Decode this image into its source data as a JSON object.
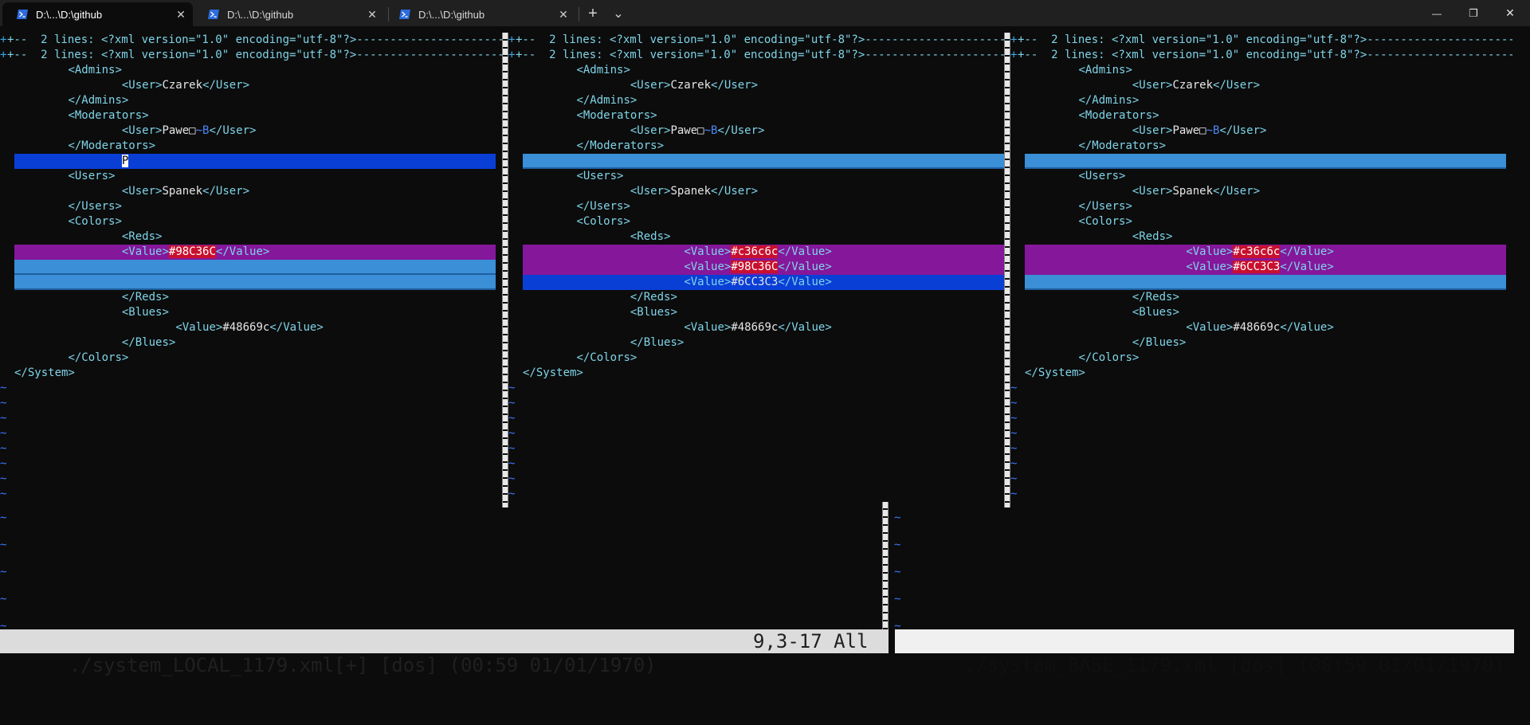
{
  "tabs": [
    {
      "label": "D:\\...\\D:\\github",
      "close": "✕",
      "active": true
    },
    {
      "label": "D:\\...\\D:\\github",
      "close": "✕",
      "active": false
    },
    {
      "label": "D:\\...\\D:\\github",
      "close": "✕",
      "active": false
    }
  ],
  "toolbar": {
    "new_tab": "+",
    "dropdown": "⌄"
  },
  "window_controls": {
    "minimize": "—",
    "restore": "❐",
    "close": "✕"
  },
  "colors": {
    "diff_add_line": "#0a3fd6",
    "diff_change_line": "#85179b",
    "diff_change_text": "#c8102e",
    "diff_delete_filler": "#3a8fd6",
    "background": "#0c0c0c",
    "tag": "#7fd4e8",
    "tilde": "#3b78ff"
  },
  "fold_text": "+--  2 lines: <?xml version=\"1.0\" encoding=\"utf-8\"?>-------------------------------",
  "panes": [
    {
      "name": "local",
      "cursor_char": "P",
      "lines": [
        {
          "type": "fold",
          "sign": "+"
        },
        {
          "type": "fold",
          "sign": "+"
        },
        {
          "type": "code",
          "indent": 1,
          "tag": "<Admins>"
        },
        {
          "type": "code",
          "indent": 2,
          "open": "<User>",
          "text": "Czarek",
          "close": "</User>"
        },
        {
          "type": "code",
          "indent": 1,
          "tag": "</Admins>"
        },
        {
          "type": "code",
          "indent": 1,
          "tag": "<Moderators>"
        },
        {
          "type": "code",
          "indent": 2,
          "open": "<User>",
          "text": "Pawe□",
          "special": "~B",
          "close": "</User>"
        },
        {
          "type": "code",
          "indent": 1,
          "tag": "</Moderators>"
        },
        {
          "type": "add",
          "indent": 2,
          "cursor": true
        },
        {
          "type": "code",
          "indent": 1,
          "tag": "<Users>"
        },
        {
          "type": "code",
          "indent": 2,
          "open": "<User>",
          "text": "Spanek",
          "close": "</User>"
        },
        {
          "type": "code",
          "indent": 1,
          "tag": "</Users>"
        },
        {
          "type": "code",
          "indent": 1,
          "tag": "<Colors>"
        },
        {
          "type": "code",
          "indent": 2,
          "tag": "<Reds>"
        },
        {
          "type": "change",
          "indent": 2,
          "open": "<Value>",
          "text": "#98C36C",
          "close": "</Value>"
        },
        {
          "type": "filler"
        },
        {
          "type": "filler"
        },
        {
          "type": "code",
          "indent": 2,
          "tag": "</Reds>"
        },
        {
          "type": "code",
          "indent": 2,
          "tag": "<Blues>"
        },
        {
          "type": "code",
          "indent": 3,
          "open": "<Value>",
          "text": "#48669c",
          "close": "</Value>"
        },
        {
          "type": "code",
          "indent": 2,
          "tag": "</Blues>"
        },
        {
          "type": "code",
          "indent": 1,
          "tag": "</Colors>"
        },
        {
          "type": "code",
          "indent": 0,
          "tag": "</System>"
        }
      ]
    },
    {
      "name": "remote",
      "lines": [
        {
          "type": "fold",
          "sign": "+"
        },
        {
          "type": "fold",
          "sign": "+"
        },
        {
          "type": "code",
          "indent": 1,
          "tag": "<Admins>"
        },
        {
          "type": "code",
          "indent": 2,
          "open": "<User>",
          "text": "Czarek",
          "close": "</User>"
        },
        {
          "type": "code",
          "indent": 1,
          "tag": "</Admins>"
        },
        {
          "type": "code",
          "indent": 1,
          "tag": "<Moderators>"
        },
        {
          "type": "code",
          "indent": 2,
          "open": "<User>",
          "text": "Pawe□",
          "special": "~B",
          "close": "</User>"
        },
        {
          "type": "code",
          "indent": 1,
          "tag": "</Moderators>"
        },
        {
          "type": "filler"
        },
        {
          "type": "code",
          "indent": 1,
          "tag": "<Users>"
        },
        {
          "type": "code",
          "indent": 2,
          "open": "<User>",
          "text": "Spanek",
          "close": "</User>"
        },
        {
          "type": "code",
          "indent": 1,
          "tag": "</Users>"
        },
        {
          "type": "code",
          "indent": 1,
          "tag": "<Colors>"
        },
        {
          "type": "code",
          "indent": 2,
          "tag": "<Reds>"
        },
        {
          "type": "change",
          "indent": 3,
          "open": "<Value>",
          "text": "#c36c6c",
          "close": "</Value>"
        },
        {
          "type": "change2",
          "indent": 3,
          "open": "<Value>",
          "text": "#98C36C",
          "close": "</Value>"
        },
        {
          "type": "addline",
          "indent": 3,
          "open": "<Value>",
          "text": "#6CC3C3",
          "close": "</Value>"
        },
        {
          "type": "code",
          "indent": 2,
          "tag": "</Reds>"
        },
        {
          "type": "code",
          "indent": 2,
          "tag": "<Blues>"
        },
        {
          "type": "code",
          "indent": 3,
          "open": "<Value>",
          "text": "#48669c",
          "close": "</Value>"
        },
        {
          "type": "code",
          "indent": 2,
          "tag": "</Blues>"
        },
        {
          "type": "code",
          "indent": 1,
          "tag": "</Colors>"
        },
        {
          "type": "code",
          "indent": 0,
          "tag": "</System>"
        }
      ]
    },
    {
      "name": "base",
      "lines": [
        {
          "type": "fold",
          "sign": "+"
        },
        {
          "type": "fold",
          "sign": "+"
        },
        {
          "type": "code",
          "indent": 1,
          "tag": "<Admins>"
        },
        {
          "type": "code",
          "indent": 2,
          "open": "<User>",
          "text": "Czarek",
          "close": "</User>"
        },
        {
          "type": "code",
          "indent": 1,
          "tag": "</Admins>"
        },
        {
          "type": "code",
          "indent": 1,
          "tag": "<Moderators>"
        },
        {
          "type": "code",
          "indent": 2,
          "open": "<User>",
          "text": "Pawe□",
          "special": "~B",
          "close": "</User>"
        },
        {
          "type": "code",
          "indent": 1,
          "tag": "</Moderators>"
        },
        {
          "type": "filler"
        },
        {
          "type": "code",
          "indent": 1,
          "tag": "<Users>"
        },
        {
          "type": "code",
          "indent": 2,
          "open": "<User>",
          "text": "Spanek",
          "close": "</User>"
        },
        {
          "type": "code",
          "indent": 1,
          "tag": "</Users>"
        },
        {
          "type": "code",
          "indent": 1,
          "tag": "<Colors>"
        },
        {
          "type": "code",
          "indent": 2,
          "tag": "<Reds>"
        },
        {
          "type": "change",
          "indent": 3,
          "open": "<Value>",
          "text": "#c36c6c",
          "close": "</Value>"
        },
        {
          "type": "change2",
          "indent": 3,
          "open": "<Value>",
          "text": "#6CC3C3",
          "close": "</Value>"
        },
        {
          "type": "filler"
        },
        {
          "type": "code",
          "indent": 2,
          "tag": "</Reds>"
        },
        {
          "type": "code",
          "indent": 2,
          "tag": "<Blues>"
        },
        {
          "type": "code",
          "indent": 3,
          "open": "<Value>",
          "text": "#48669c",
          "close": "</Value>"
        },
        {
          "type": "code",
          "indent": 2,
          "tag": "</Blues>"
        },
        {
          "type": "code",
          "indent": 1,
          "tag": "</Colors>"
        },
        {
          "type": "code",
          "indent": 0,
          "tag": "</System>"
        }
      ]
    }
  ],
  "tilde": "~",
  "status": {
    "left_file": "./system_LOCAL_1179.xml[+] [dos] (00:59 01/01/1970)",
    "left_pos": "9,3-17 All",
    "right_file": "./system_BASE_1179.xml [dos] (00:59 01/01/1970)"
  }
}
